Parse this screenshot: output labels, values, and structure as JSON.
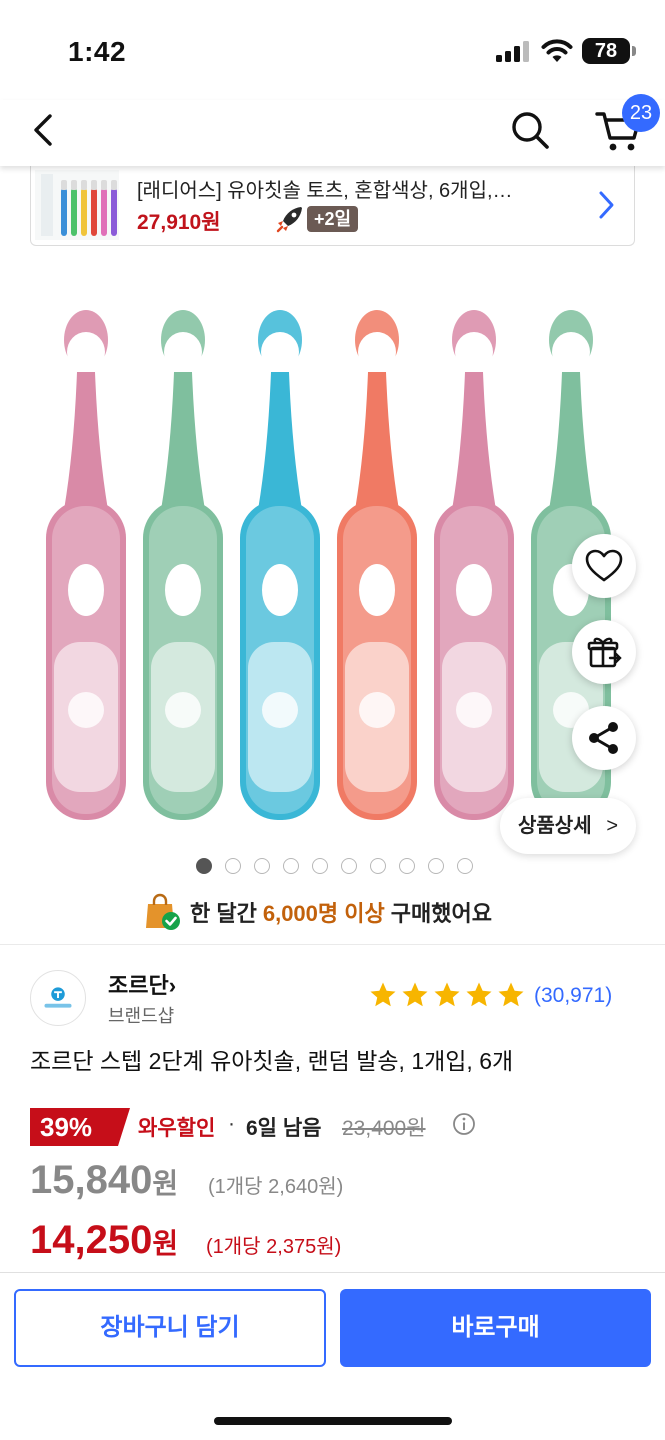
{
  "status_bar": {
    "time": "1:42",
    "battery": "78"
  },
  "nav": {
    "cart_count": "23"
  },
  "mini_product": {
    "title": "[래디어스] 유아칫솔 토츠, 혼합색상, 6개입,…",
    "price": "27,910원",
    "delivery_tag": "+2일"
  },
  "hero": {
    "detail_button": "상품상세",
    "detail_chevron": ">",
    "toothbrush_colors": [
      "#d98aa7",
      "#7fbf9e",
      "#3ab7d6",
      "#f07a64",
      "#d98aa7",
      "#7fbf9e"
    ],
    "dot_count": 10,
    "active_dot": 0
  },
  "buyers": {
    "prefix": "한 달간",
    "highlight": "6,000명 이상",
    "suffix": "구매했어요"
  },
  "brand": {
    "name": "조르단",
    "chevron": "›",
    "shop_label": "브랜드샵",
    "rating_stars": 5,
    "rating_count": "(30,971)"
  },
  "product": {
    "title": "조르단 스텝 2단계 유아칫솔, 랜덤 발송, 1개입, 6개"
  },
  "pricing": {
    "discount_badge": "39%",
    "wow_label": "와우할인",
    "separator": "·",
    "days_left": "6일 남음",
    "original_price": "23,400원",
    "price_regular": "15,840",
    "price_regular_unit": "원",
    "unit_price_regular": "(1개당 2,640원)",
    "price_wow": "14,250",
    "price_wow_unit": "원",
    "unit_price_wow": "(1개당 2,375원)"
  },
  "actions": {
    "add_to_cart": "장바구니 담기",
    "buy_now": "바로구매"
  },
  "colors": {
    "accent": "#346aff",
    "price_red": "#c60e19",
    "highlight_orange": "#c2610b"
  }
}
